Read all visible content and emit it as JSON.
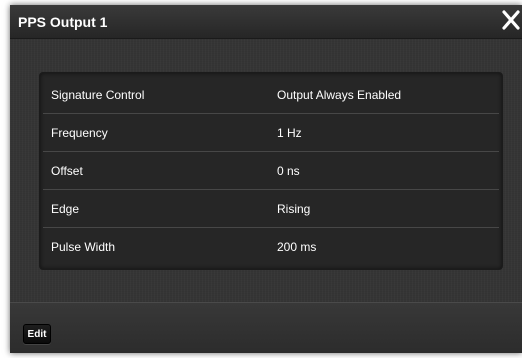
{
  "dialog": {
    "title": "PPS Output 1",
    "close_icon": "close-icon"
  },
  "rows": [
    {
      "label": "Signature Control",
      "value": "Output Always Enabled"
    },
    {
      "label": "Frequency",
      "value": "1 Hz"
    },
    {
      "label": "Offset",
      "value": "0 ns"
    },
    {
      "label": "Edge",
      "value": "Rising"
    },
    {
      "label": "Pulse Width",
      "value": "200 ms"
    }
  ],
  "footer": {
    "edit_label": "Edit"
  },
  "colors": {
    "dialog_bg": "#2e2e2e",
    "panel_bg": "#262626",
    "text": "#ffffff",
    "button_bg": "#111111"
  }
}
